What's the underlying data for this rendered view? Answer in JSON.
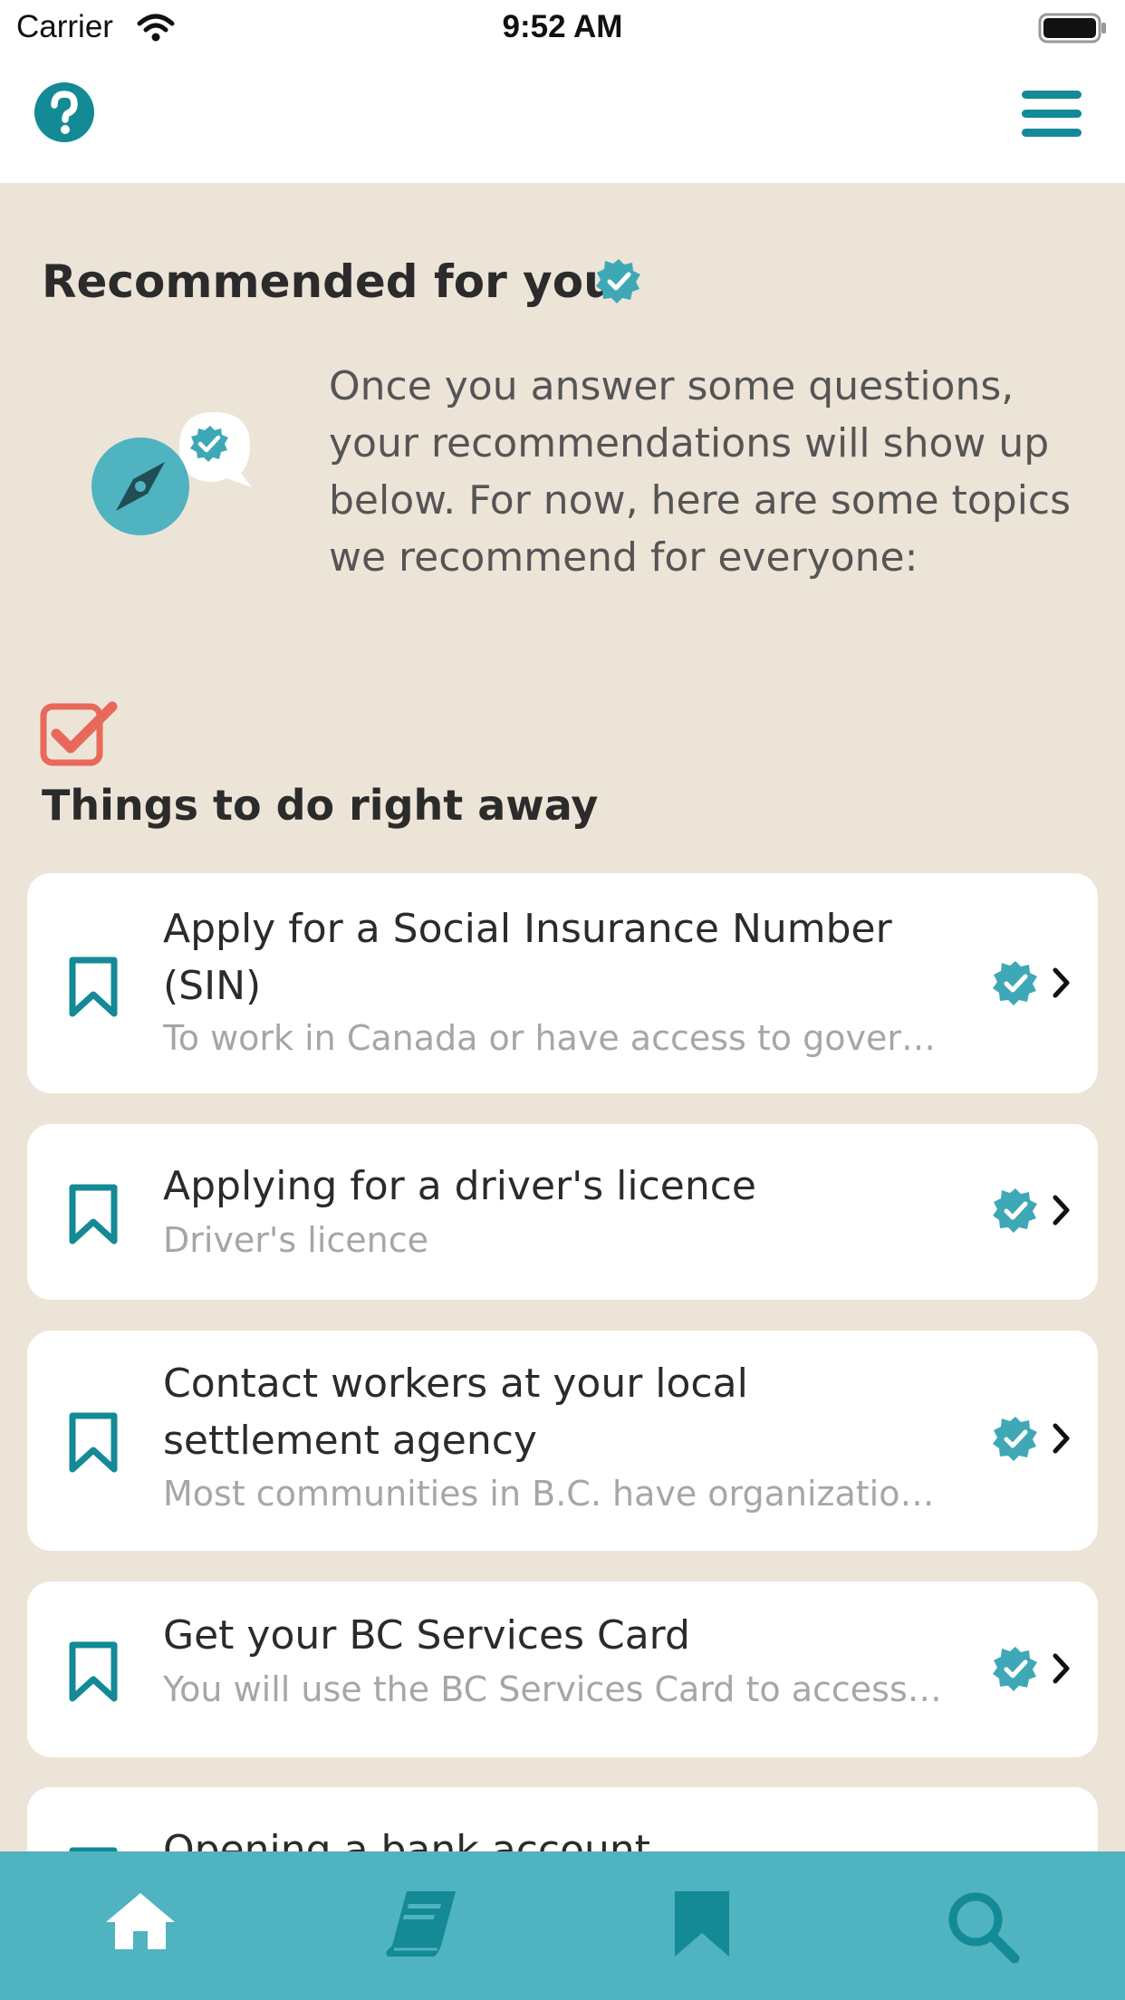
{
  "status_bar": {
    "carrier": "Carrier",
    "time": "9:52 AM"
  },
  "colors": {
    "teal": "#138a95",
    "teal_light": "#4fb3c0",
    "dark_teal": "#1f4f55",
    "coral": "#e8685a",
    "beige": "#ede4d8"
  },
  "header": {
    "help_icon": "question-circle-icon",
    "menu_icon": "hamburger-menu-icon"
  },
  "recommended": {
    "title": "Recommended for you",
    "intro": "Once you answer some questions, your recommendations will show up below. For now, here are some topics we recommend for everyone:"
  },
  "section": {
    "title": "Things to do right away",
    "icon": "checked-box-icon"
  },
  "cards": [
    {
      "title": "Apply for a Social Insurance Number (SIN)",
      "description": "To work in Canada or have access to gover…"
    },
    {
      "title": "Applying for a driver's licence",
      "description": "Driver's licence"
    },
    {
      "title": "Contact workers at your local settlement agency",
      "description": "Most communities in B.C. have organizatio…"
    },
    {
      "title": "Get your BC Services Card",
      "description": "You will use the BC Services Card to access…"
    },
    {
      "title": "Opening a bank account",
      "description": ""
    }
  ],
  "tabs": [
    {
      "icon": "home-icon"
    },
    {
      "icon": "book-icon"
    },
    {
      "icon": "bookmark-icon"
    },
    {
      "icon": "search-icon"
    }
  ]
}
